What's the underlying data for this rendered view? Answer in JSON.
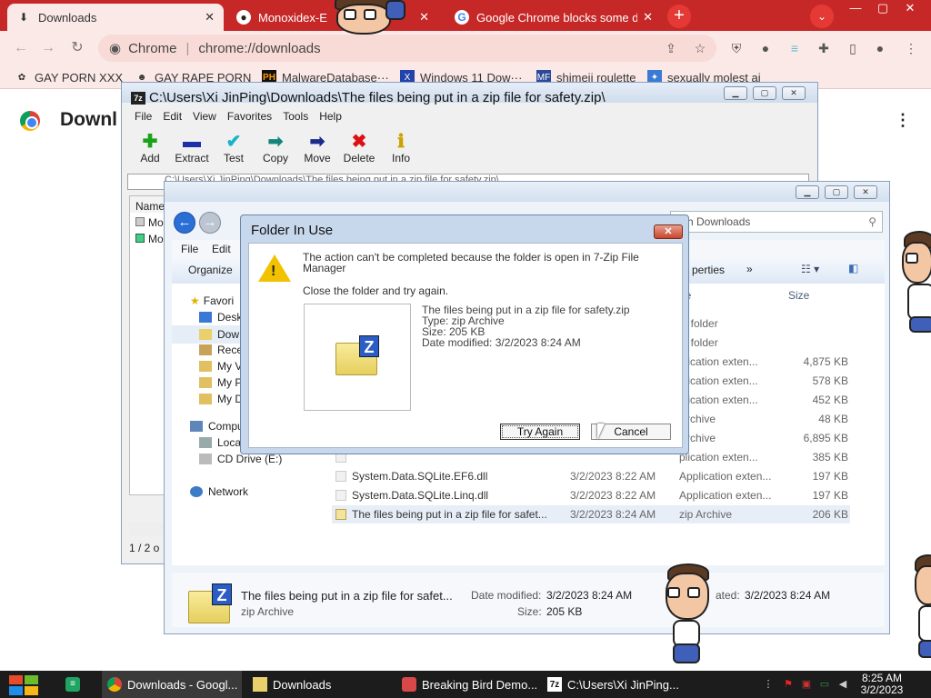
{
  "chrome": {
    "tabs": [
      {
        "label": "Downloads",
        "active": true
      },
      {
        "label": "Monoxidex-E"
      },
      {
        "label": "Google Chrome blocks some d"
      }
    ],
    "new_tab": "+",
    "tab_search": "⌄",
    "window_controls": [
      "—",
      "▢",
      "✕"
    ],
    "omnibox": {
      "site": "Chrome",
      "url": "chrome://downloads"
    },
    "bookmarks": [
      "GAY PORN XXX",
      "GAY RAPE PORN",
      "MalwareDatabase···",
      "Windows 11 Dow···",
      "shimeji roulette",
      "sexually molest ai"
    ],
    "page_title": "Downl",
    "colors": {
      "tabbar": "#c62828",
      "toolbar": "#fbe9e7"
    }
  },
  "zip_window": {
    "title": "C:\\Users\\Xi JinPing\\Downloads\\The files being put in a zip file for safety.zip\\",
    "app_icon": "7z",
    "menu": [
      "File",
      "Edit",
      "View",
      "Favorites",
      "Tools",
      "Help"
    ],
    "tools": [
      {
        "label": "Add",
        "icon": "plus-icon"
      },
      {
        "label": "Extract",
        "icon": "minus-icon"
      },
      {
        "label": "Test",
        "icon": "check-icon"
      },
      {
        "label": "Copy",
        "icon": "copy-arrow-icon"
      },
      {
        "label": "Move",
        "icon": "move-arrow-icon"
      },
      {
        "label": "Delete",
        "icon": "delete-icon"
      },
      {
        "label": "Info",
        "icon": "info-icon"
      }
    ],
    "path": "C:\\Users\\Xi JinPing\\Downloads\\The files being put in a zip file for safety.zip\\",
    "list_header": "Name",
    "list_items": [
      "Mo",
      "Mo"
    ],
    "status": "1 / 2 o"
  },
  "explorer_window": {
    "search_placeholder": "rch Downloads",
    "menu": [
      "File",
      "Edit"
    ],
    "organize": "Organize",
    "properties": "perties",
    "more": "»",
    "tree": [
      "Favori",
      "Desk",
      "Dow",
      "Rece",
      "My V",
      "My P",
      "My D",
      "Compu",
      "Loca",
      "CD Drive (E:)",
      "Network"
    ],
    "columns": {
      "type": "pe",
      "size": "Size"
    },
    "files": [
      {
        "name": "",
        "date": "",
        "type": "le folder",
        "size": ""
      },
      {
        "name": "",
        "date": "",
        "type": "le folder",
        "size": ""
      },
      {
        "name": "",
        "date": "",
        "type": "plication exten...",
        "size": "4,875 KB"
      },
      {
        "name": "",
        "date": "",
        "type": "plication exten...",
        "size": "578 KB"
      },
      {
        "name": "",
        "date": "",
        "type": "plication exten...",
        "size": "452 KB"
      },
      {
        "name": "",
        "date": "",
        "type": "Archive",
        "size": "48 KB"
      },
      {
        "name": "",
        "date": "",
        "type": "Archive",
        "size": "6,895 KB"
      },
      {
        "name": "",
        "date": "",
        "type": "plication exten...",
        "size": "385 KB"
      },
      {
        "name": "System.Data.SQLite.EF6.dll",
        "date": "3/2/2023 8:22 AM",
        "type": "Application exten...",
        "size": "197 KB"
      },
      {
        "name": "System.Data.SQLite.Linq.dll",
        "date": "3/2/2023 8:22 AM",
        "type": "Application exten...",
        "size": "197 KB"
      },
      {
        "name": "The files being put in a zip file for safet...",
        "date": "3/2/2023 8:24 AM",
        "type": "zip Archive",
        "size": "206 KB",
        "selected": true
      }
    ],
    "details": {
      "name": "The files being put in a zip file for safet...",
      "type": "zip Archive",
      "modified_label": "Date modified:",
      "modified_value": "3/2/2023 8:24 AM",
      "size_label": "Size:",
      "size_value": "205 KB",
      "created_label": "ated:",
      "created_value": "3/2/2023 8:24 AM"
    }
  },
  "dialog": {
    "title": "Folder In Use",
    "close": "✕",
    "message": "The action can't be completed because the folder is open in 7-Zip File Manager",
    "instruction": "Close the folder and try again.",
    "file_name": "The files being put in a zip file for safety.zip",
    "file_type": "Type: zip Archive",
    "file_size": "Size: 205 KB",
    "file_modified": "Date modified: 3/2/2023 8:24 AM",
    "try_again": "Try Again",
    "cancel": "Cancel"
  },
  "taskbar": {
    "tasks": [
      {
        "label": "Downloads - Googl...",
        "icon": "chrome-icon",
        "active": true
      },
      {
        "label": "Downloads",
        "icon": "folder-icon"
      },
      {
        "label": "Breaking Bird Demo...",
        "icon": "app-icon"
      },
      {
        "label": "C:\\Users\\Xi JinPing...",
        "icon": "7zip-icon"
      }
    ],
    "time": "8:25 AM",
    "date": "3/2/2023"
  }
}
